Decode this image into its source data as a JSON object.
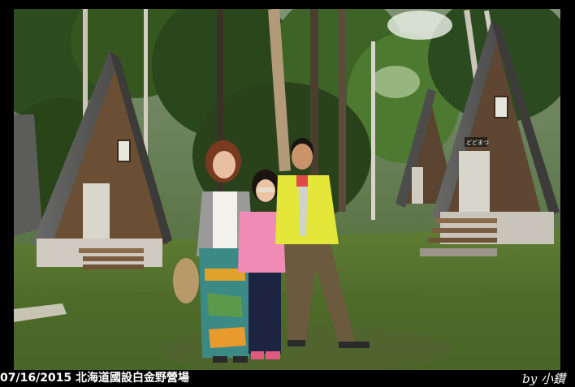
{
  "caption": {
    "date": "07/16/2015",
    "title": "北海道國設白金野營場"
  },
  "credit": {
    "text": "by 小鑽"
  },
  "photo": {
    "cabin_sign": "どどまつ",
    "description_icons": [
      "a-frame-cabin",
      "family-group",
      "forest"
    ]
  }
}
